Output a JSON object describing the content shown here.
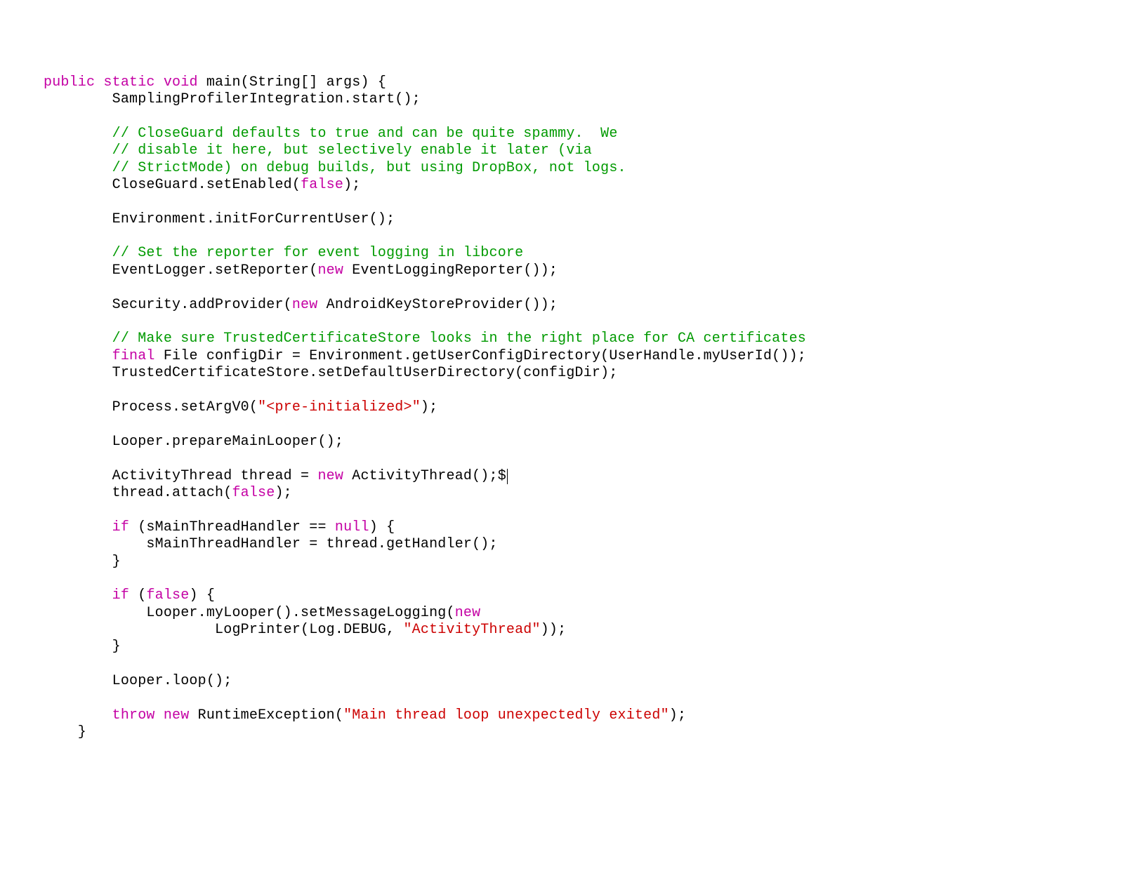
{
  "code": {
    "l0_kw1": "public",
    "l0_kw2": "static",
    "l0_kw3": "void",
    "l0_rest": " main(String[] args) {",
    "l1": "        SamplingProfilerIntegration.start();",
    "l_blank": "",
    "l2c": "        // CloseGuard defaults to true and can be quite spammy.  We",
    "l3c": "        // disable it here, but selectively enable it later (via",
    "l4c": "        // StrictMode) on debug builds, but using DropBox, not logs.",
    "l5a": "        CloseGuard.setEnabled(",
    "l5_false": "false",
    "l5b": ");",
    "l6": "        Environment.initForCurrentUser();",
    "l7c": "        // Set the reporter for event logging in libcore",
    "l8a": "        EventLogger.setReporter(",
    "l8_new": "new",
    "l8b": " EventLoggingReporter());",
    "l9a": "        Security.addProvider(",
    "l9_new": "new",
    "l9b": " AndroidKeyStoreProvider());",
    "l10c": "        // Make sure TrustedCertificateStore looks in the right place for CA certificates",
    "l11_sp": "        ",
    "l11_final": "final",
    "l11b": " File configDir = Environment.getUserConfigDirectory(UserHandle.myUserId());",
    "l12": "        TrustedCertificateStore.setDefaultUserDirectory(configDir);",
    "l13a": "        Process.setArgV0(",
    "l13_str": "\"<pre-initialized>\"",
    "l13b": ");",
    "l14": "        Looper.prepareMainLooper();",
    "l15a": "        ActivityThread thread = ",
    "l15_new": "new",
    "l15b": " ActivityThread();$",
    "l16a": "        thread.attach(",
    "l16_false": "false",
    "l16b": ");",
    "l17_sp": "        ",
    "l17_if": "if",
    "l17a": " (sMainThreadHandler == ",
    "l17_null": "null",
    "l17b": ") {",
    "l18": "            sMainThreadHandler = thread.getHandler();",
    "l19": "        }",
    "l20_sp": "        ",
    "l20_if": "if",
    "l20a": " (",
    "l20_false": "false",
    "l20b": ") {",
    "l21a": "            Looper.myLooper().setMessageLogging(",
    "l21_new": "new",
    "l22a": "                    LogPrinter(Log.DEBUG, ",
    "l22_str": "\"ActivityThread\"",
    "l22b": "));",
    "l23": "        }",
    "l24": "        Looper.loop();",
    "l25_sp": "        ",
    "l25_throw": "throw",
    "l25_sp2": " ",
    "l25_new": "new",
    "l25a": " RuntimeException(",
    "l25_str": "\"Main thread loop unexpectedly exited\"",
    "l25b": ");",
    "l26": "    }"
  }
}
